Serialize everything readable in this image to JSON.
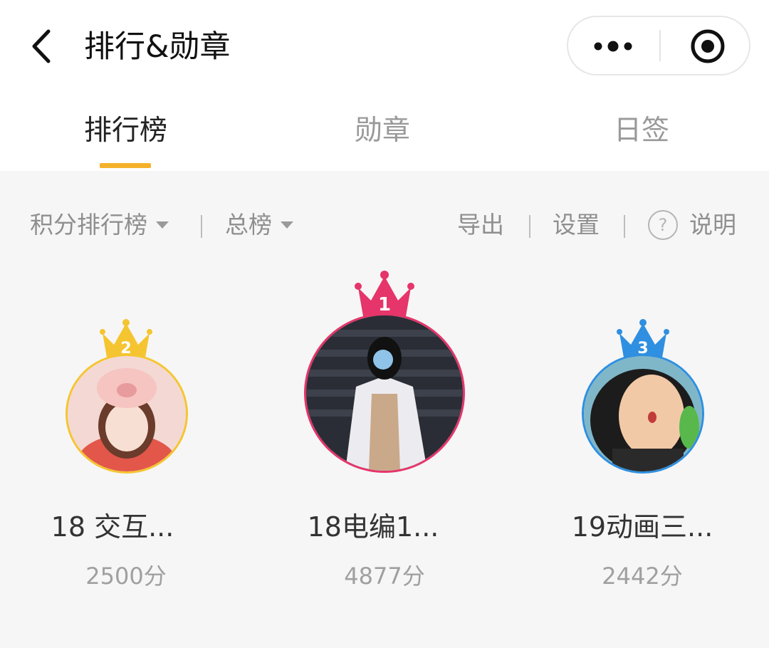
{
  "header": {
    "title": "排行&勋章",
    "back_icon": "chevron-left-icon",
    "more_icon": "more-dots-icon",
    "target_icon": "target-icon"
  },
  "tabs": [
    {
      "label": "排行榜",
      "active": true
    },
    {
      "label": "勋章",
      "active": false
    },
    {
      "label": "日签",
      "active": false
    }
  ],
  "filters": {
    "ranking_type": "积分排行榜",
    "range": "总榜",
    "export": "导出",
    "settings": "设置",
    "help_mark": "?",
    "help": "说明"
  },
  "colors": {
    "accent": "#f4b12b",
    "rank1": "#e5356a",
    "rank2": "#f5c531",
    "rank3": "#2f8fe0"
  },
  "podium": [
    {
      "rank": "2",
      "name": "18 交互...",
      "score": "2500分"
    },
    {
      "rank": "1",
      "name": "18电编1...",
      "score": "4877分"
    },
    {
      "rank": "3",
      "name": "19动画三...",
      "score": "2442分"
    }
  ]
}
